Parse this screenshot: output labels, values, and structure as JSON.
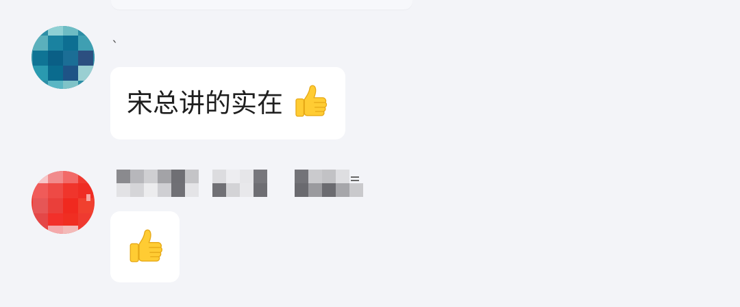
{
  "chat": {
    "messages": [
      {
        "sender": {
          "name": "`",
          "avatar_colors": [
            "#7fc3c8",
            "#0a7a96",
            "#1b5d88",
            "#2a9ab0"
          ]
        },
        "text": "宋总讲的实在",
        "emoji": "thumbs-up"
      },
      {
        "sender": {
          "name_shown_as": "pixelated",
          "avatar_colors": [
            "#f4a9ab",
            "#ee4a45",
            "#f0291f",
            "#e45a5a"
          ]
        },
        "emoji": "thumbs-up"
      }
    ]
  },
  "colors": {
    "background": "#f3f4f8",
    "bubble": "#ffffff",
    "text": "#1f1f1f",
    "emoji_yellow": "#ffcc33"
  }
}
